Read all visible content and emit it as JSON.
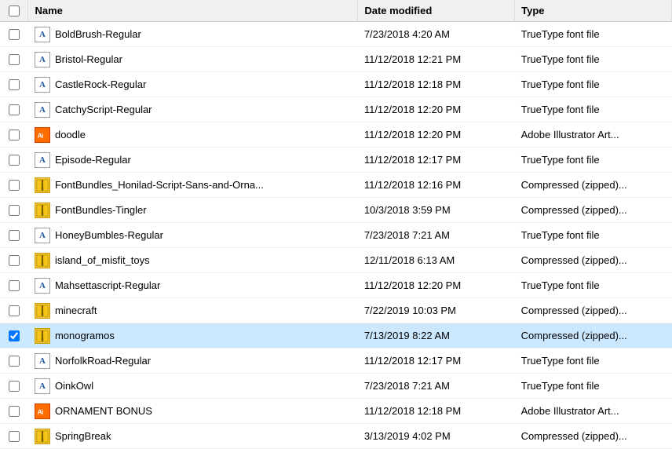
{
  "table": {
    "columns": [
      {
        "id": "checkbox",
        "label": ""
      },
      {
        "id": "name",
        "label": "Name"
      },
      {
        "id": "date",
        "label": "Date modified"
      },
      {
        "id": "type",
        "label": "Type"
      }
    ],
    "rows": [
      {
        "id": 1,
        "checkbox": false,
        "selected": false,
        "icon": "font",
        "name": "BoldBrush-Regular",
        "date": "7/23/2018 4:20 AM",
        "type": "TrueType font file"
      },
      {
        "id": 2,
        "checkbox": false,
        "selected": false,
        "icon": "font",
        "name": "Bristol-Regular",
        "date": "11/12/2018 12:21 PM",
        "type": "TrueType font file"
      },
      {
        "id": 3,
        "checkbox": false,
        "selected": false,
        "icon": "font",
        "name": "CastleRock-Regular",
        "date": "11/12/2018 12:18 PM",
        "type": "TrueType font file"
      },
      {
        "id": 4,
        "checkbox": false,
        "selected": false,
        "icon": "font",
        "name": "CatchyScript-Regular",
        "date": "11/12/2018 12:20 PM",
        "type": "TrueType font file"
      },
      {
        "id": 5,
        "checkbox": false,
        "selected": false,
        "icon": "ai",
        "name": "doodle",
        "date": "11/12/2018 12:20 PM",
        "type": "Adobe Illustrator Art..."
      },
      {
        "id": 6,
        "checkbox": false,
        "selected": false,
        "icon": "font",
        "name": "Episode-Regular",
        "date": "11/12/2018 12:17 PM",
        "type": "TrueType font file"
      },
      {
        "id": 7,
        "checkbox": false,
        "selected": false,
        "icon": "zip",
        "name": "FontBundles_Honilad-Script-Sans-and-Orna...",
        "date": "11/12/2018 12:16 PM",
        "type": "Compressed (zipped)..."
      },
      {
        "id": 8,
        "checkbox": false,
        "selected": false,
        "icon": "zip",
        "name": "FontBundles-Tingler",
        "date": "10/3/2018 3:59 PM",
        "type": "Compressed (zipped)..."
      },
      {
        "id": 9,
        "checkbox": false,
        "selected": false,
        "icon": "font",
        "name": "HoneyBumbles-Regular",
        "date": "7/23/2018 7:21 AM",
        "type": "TrueType font file"
      },
      {
        "id": 10,
        "checkbox": false,
        "selected": false,
        "icon": "zip",
        "name": "island_of_misfit_toys",
        "date": "12/11/2018 6:13 AM",
        "type": "Compressed (zipped)..."
      },
      {
        "id": 11,
        "checkbox": false,
        "selected": false,
        "icon": "font",
        "name": "Mahsettascript-Regular",
        "date": "11/12/2018 12:20 PM",
        "type": "TrueType font file"
      },
      {
        "id": 12,
        "checkbox": false,
        "selected": false,
        "icon": "zip",
        "name": "minecraft",
        "date": "7/22/2019 10:03 PM",
        "type": "Compressed (zipped)..."
      },
      {
        "id": 13,
        "checkbox": true,
        "selected": true,
        "icon": "zip",
        "name": "monogramos",
        "date": "7/13/2019 8:22 AM",
        "type": "Compressed (zipped)..."
      },
      {
        "id": 14,
        "checkbox": false,
        "selected": false,
        "icon": "font",
        "name": "NorfolkRoad-Regular",
        "date": "11/12/2018 12:17 PM",
        "type": "TrueType font file"
      },
      {
        "id": 15,
        "checkbox": false,
        "selected": false,
        "icon": "font",
        "name": "OinkOwl",
        "date": "7/23/2018 7:21 AM",
        "type": "TrueType font file"
      },
      {
        "id": 16,
        "checkbox": false,
        "selected": false,
        "icon": "ai",
        "name": "ORNAMENT BONUS",
        "date": "11/12/2018 12:18 PM",
        "type": "Adobe Illustrator Art..."
      },
      {
        "id": 17,
        "checkbox": false,
        "selected": false,
        "icon": "zip",
        "name": "SpringBreak",
        "date": "3/13/2019 4:02 PM",
        "type": "Compressed (zipped)..."
      }
    ]
  }
}
